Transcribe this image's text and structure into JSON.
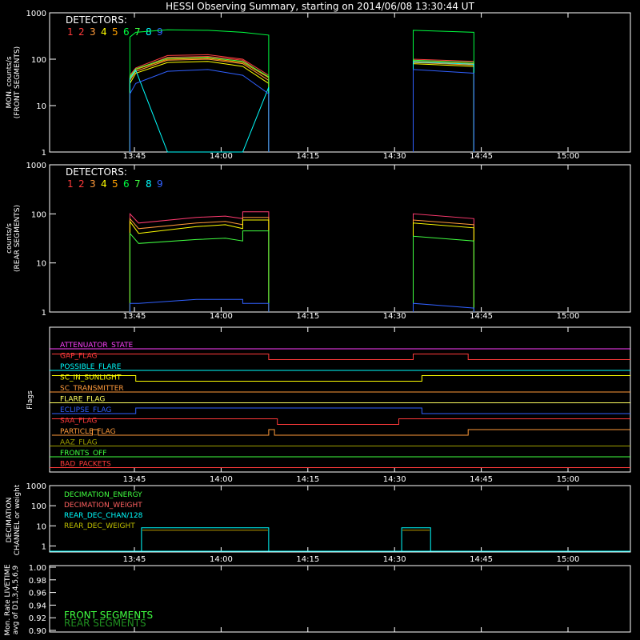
{
  "title": "HESSI Observing Summary, starting on 2014/06/08 13:30:44 UT",
  "time_ticks": [
    "13:45",
    "14:00",
    "14:15",
    "14:30",
    "14:45",
    "15:00"
  ],
  "colors": {
    "d1": "#ff3a3a",
    "d2": "#ff3a3a",
    "d3": "#ff9a3a",
    "d4": "#ffff00",
    "d5": "#ffa000",
    "d6": "#00ff40",
    "d7": "#40ff40",
    "d8": "#00ffff",
    "d9": "#3060ff"
  },
  "chart_data": [
    {
      "type": "line",
      "panel": "front",
      "ylabel": [
        "MON. counts/s",
        "(FRONT SEGMENTS)"
      ],
      "yscale": "log",
      "ylim": [
        1,
        1000
      ],
      "ytick_labels": [
        "1",
        "10",
        "100",
        "1000"
      ],
      "legend_title": "DETECTORS:",
      "legend_numbers": [
        "1",
        "2",
        "3",
        "4",
        "5",
        "6",
        "7",
        "8",
        "9"
      ],
      "segments_x_minutes": [
        [
          13.5,
          37.5
        ],
        [
          62.5,
          73.0
        ]
      ],
      "series": [
        {
          "name": "1",
          "values": [
            40,
            60,
            110,
            115,
            95,
            40,
            90,
            80
          ]
        },
        {
          "name": "2",
          "values": [
            45,
            65,
            120,
            125,
            100,
            45,
            100,
            90
          ]
        },
        {
          "name": "3",
          "values": [
            35,
            55,
            95,
            100,
            80,
            35,
            85,
            75
          ]
        },
        {
          "name": "4",
          "values": [
            30,
            50,
            85,
            90,
            70,
            30,
            80,
            70
          ]
        },
        {
          "name": "5",
          "values": [
            40,
            60,
            100,
            105,
            85,
            40,
            90,
            80
          ]
        },
        {
          "name": "6",
          "values": [
            300,
            380,
            430,
            420,
            380,
            330,
            420,
            380
          ]
        },
        {
          "name": "7",
          "values": [
            42,
            62,
            105,
            110,
            90,
            42,
            95,
            85
          ]
        },
        {
          "name": "8",
          "values": [
            38,
            58,
            1,
            1,
            1,
            25,
            88,
            78
          ]
        },
        {
          "name": "9",
          "values": [
            18,
            30,
            55,
            60,
            45,
            18,
            60,
            50
          ]
        }
      ]
    },
    {
      "type": "line",
      "panel": "rear",
      "ylabel": [
        "counts/s",
        "(REAR SEGMENTS)"
      ],
      "yscale": "log",
      "ylim": [
        1,
        1000
      ],
      "ytick_labels": [
        "1",
        "10",
        "100",
        "1000"
      ],
      "legend_title": "DETECTORS:",
      "legend_numbers": [
        "1",
        "2",
        "3",
        "4",
        "5",
        "6",
        "7",
        "8",
        "9"
      ],
      "series": [
        {
          "name": "1",
          "values": [
            100,
            65,
            85,
            90,
            80,
            110,
            100
          ]
        },
        {
          "name": "3",
          "values": [
            80,
            50,
            65,
            70,
            60,
            85,
            75
          ]
        },
        {
          "name": "4",
          "values": [
            70,
            40,
            55,
            60,
            50,
            75,
            65
          ]
        },
        {
          "name": "6",
          "values": [
            40,
            25,
            30,
            32,
            28,
            45,
            35
          ]
        },
        {
          "name": "9",
          "values": [
            1.5,
            1.5,
            1.8,
            1.8,
            1.8,
            1.5,
            1.5
          ]
        }
      ]
    },
    {
      "type": "step",
      "panel": "flags",
      "ylabel": "Flags",
      "flags": [
        {
          "name": "ATTENUATOR_STATE",
          "color": "#ff40ff"
        },
        {
          "name": "GAP_FLAG",
          "color": "#ff3a3a"
        },
        {
          "name": "POSSIBLE_FLARE",
          "color": "#00ffff"
        },
        {
          "name": "SC_IN_SUNLIGHT",
          "color": "#ffff00"
        },
        {
          "name": "SC_TRANSMITTER",
          "color": "#ff9a3a"
        },
        {
          "name": "FLARE_FLAG",
          "color": "#ffff60"
        },
        {
          "name": "ECLIPSE_FLAG",
          "color": "#3060ff"
        },
        {
          "name": "SAA_FLAG",
          "color": "#ff3a3a"
        },
        {
          "name": "PARTICLE_FLAG",
          "color": "#ff9a3a"
        },
        {
          "name": "AAZ_FLAG",
          "color": "#a0a000"
        },
        {
          "name": "FRONTS_OFF",
          "color": "#40ff40"
        },
        {
          "name": "BAD_PACKETS",
          "color": "#ff3a3a"
        }
      ]
    },
    {
      "type": "step",
      "panel": "decimation",
      "ylabel": [
        "DECIMATION",
        "CHANNEL or weight"
      ],
      "yscale": "log",
      "ylim": [
        0.5,
        1000
      ],
      "ytick_labels": [
        "1",
        "10",
        "100",
        "1000"
      ],
      "legend": [
        {
          "name": "DECIMATION_ENERGY",
          "color": "#40ff40"
        },
        {
          "name": "DECIMATION_WEIGHT",
          "color": "#ff6060"
        },
        {
          "name": "REAR_DEC_CHAN/128",
          "color": "#00ffff"
        },
        {
          "name": "REAR_DEC_WEIGHT",
          "color": "#c0c000"
        }
      ]
    },
    {
      "type": "line",
      "panel": "livetime",
      "ylabel": [
        "Mon. Rate LIVETIME",
        "avg of D1,3,4,5,6,9"
      ],
      "ylim": [
        0.9,
        1.0
      ],
      "ytick_labels": [
        "0.90",
        "0.92",
        "0.94",
        "0.96",
        "0.98",
        "1.00"
      ],
      "legend": [
        {
          "name": "FRONT SEGMENTS",
          "color": "#40ff40"
        },
        {
          "name": "REAR SEGMENTS",
          "color": "#209020"
        }
      ]
    }
  ]
}
